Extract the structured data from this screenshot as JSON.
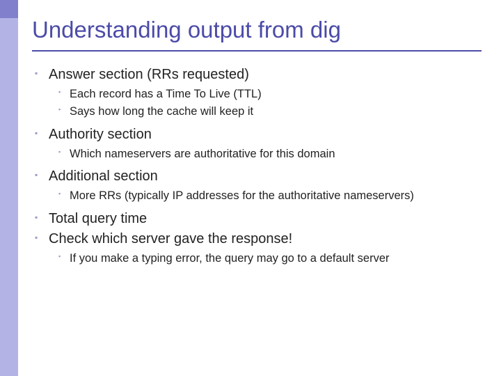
{
  "title": "Understanding output from dig",
  "bullets": {
    "b0": {
      "text": "Answer section (RRs requested)",
      "sub": {
        "s0": "Each record has a Time To Live (TTL)",
        "s1": "Says how long the cache will keep it"
      }
    },
    "b1": {
      "text": "Authority section",
      "sub": {
        "s0": "Which nameservers are authoritative for this domain"
      }
    },
    "b2": {
      "text": "Additional section",
      "sub": {
        "s0": "More RRs (typically IP addresses for the authoritative nameservers)"
      }
    },
    "b3": {
      "text": "Total query time"
    },
    "b4": {
      "text": "Check which server gave the response!",
      "sub": {
        "s0": "If you make a typing error, the query may go to a default server"
      }
    }
  }
}
